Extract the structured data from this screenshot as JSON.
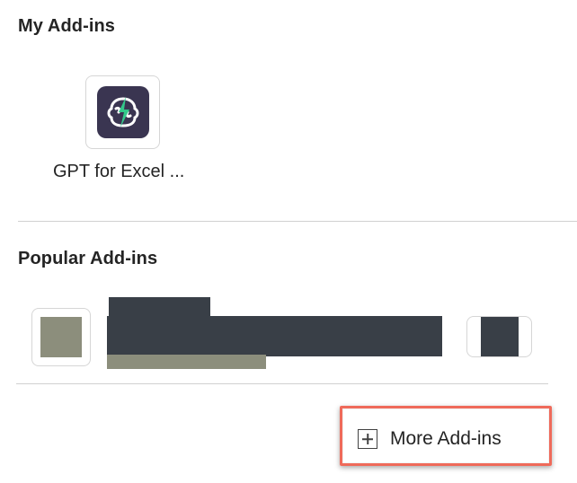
{
  "my_addins": {
    "title": "My Add-ins",
    "items": [
      {
        "name": "GPT for Excel ...",
        "icon": "gpt-for-excel-logo-icon",
        "logo_bg": "#3a3551",
        "logo_accent": "#33c98a"
      }
    ]
  },
  "popular_addins": {
    "title": "Popular Add-ins",
    "redaction_colors": {
      "dark": "#393f47",
      "muted": "#8c8e7c"
    }
  },
  "footer": {
    "more_label": "More Add-ins",
    "more_icon": "plus-square-icon",
    "highlight_color": "#ef6a5a"
  }
}
